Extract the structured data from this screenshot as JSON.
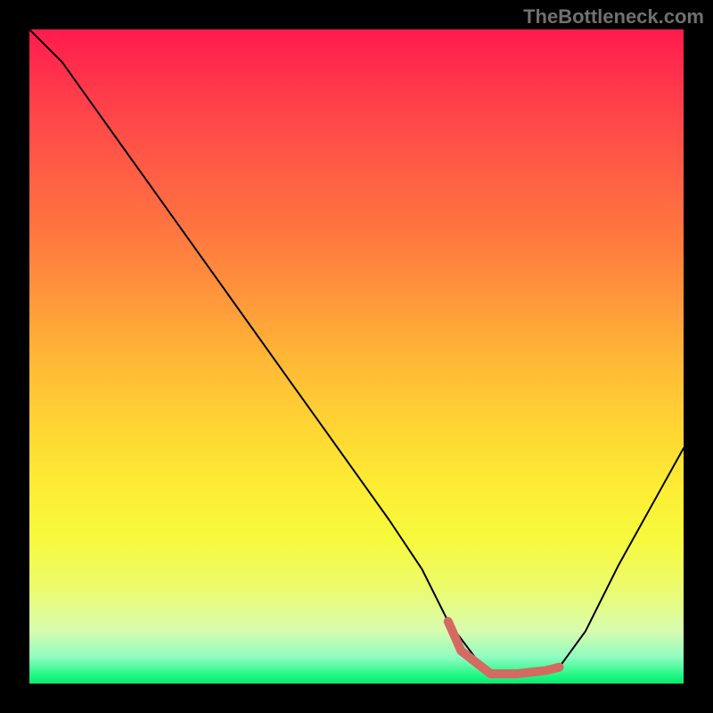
{
  "watermark": "TheBottleneck.com",
  "chart_data": {
    "type": "line",
    "title": "",
    "xlabel": "",
    "ylabel": "",
    "xlim": [
      0,
      1
    ],
    "ylim": [
      0,
      1
    ],
    "x": [
      0.0,
      0.02,
      0.05,
      0.1,
      0.15,
      0.2,
      0.25,
      0.3,
      0.35,
      0.4,
      0.45,
      0.5,
      0.55,
      0.6,
      0.64,
      0.7,
      0.76,
      0.81,
      0.85,
      0.9,
      0.95,
      1.0
    ],
    "values": [
      1.0,
      0.98,
      0.95,
      0.88,
      0.81,
      0.74,
      0.67,
      0.6,
      0.53,
      0.46,
      0.39,
      0.32,
      0.25,
      0.175,
      0.095,
      0.015,
      0.015,
      0.025,
      0.08,
      0.18,
      0.27,
      0.36
    ],
    "highlight_segment": {
      "color": "#d46a61",
      "x": [
        0.64,
        0.66,
        0.705,
        0.745,
        0.79,
        0.81
      ],
      "values": [
        0.095,
        0.05,
        0.015,
        0.015,
        0.02,
        0.025
      ]
    },
    "gradient": {
      "stops": [
        {
          "pos": 0.0,
          "color": "#ff1a4e"
        },
        {
          "pos": 0.5,
          "color": "#ffb636"
        },
        {
          "pos": 0.8,
          "color": "#f6fa3d"
        },
        {
          "pos": 1.0,
          "color": "#11e66e"
        }
      ]
    }
  }
}
